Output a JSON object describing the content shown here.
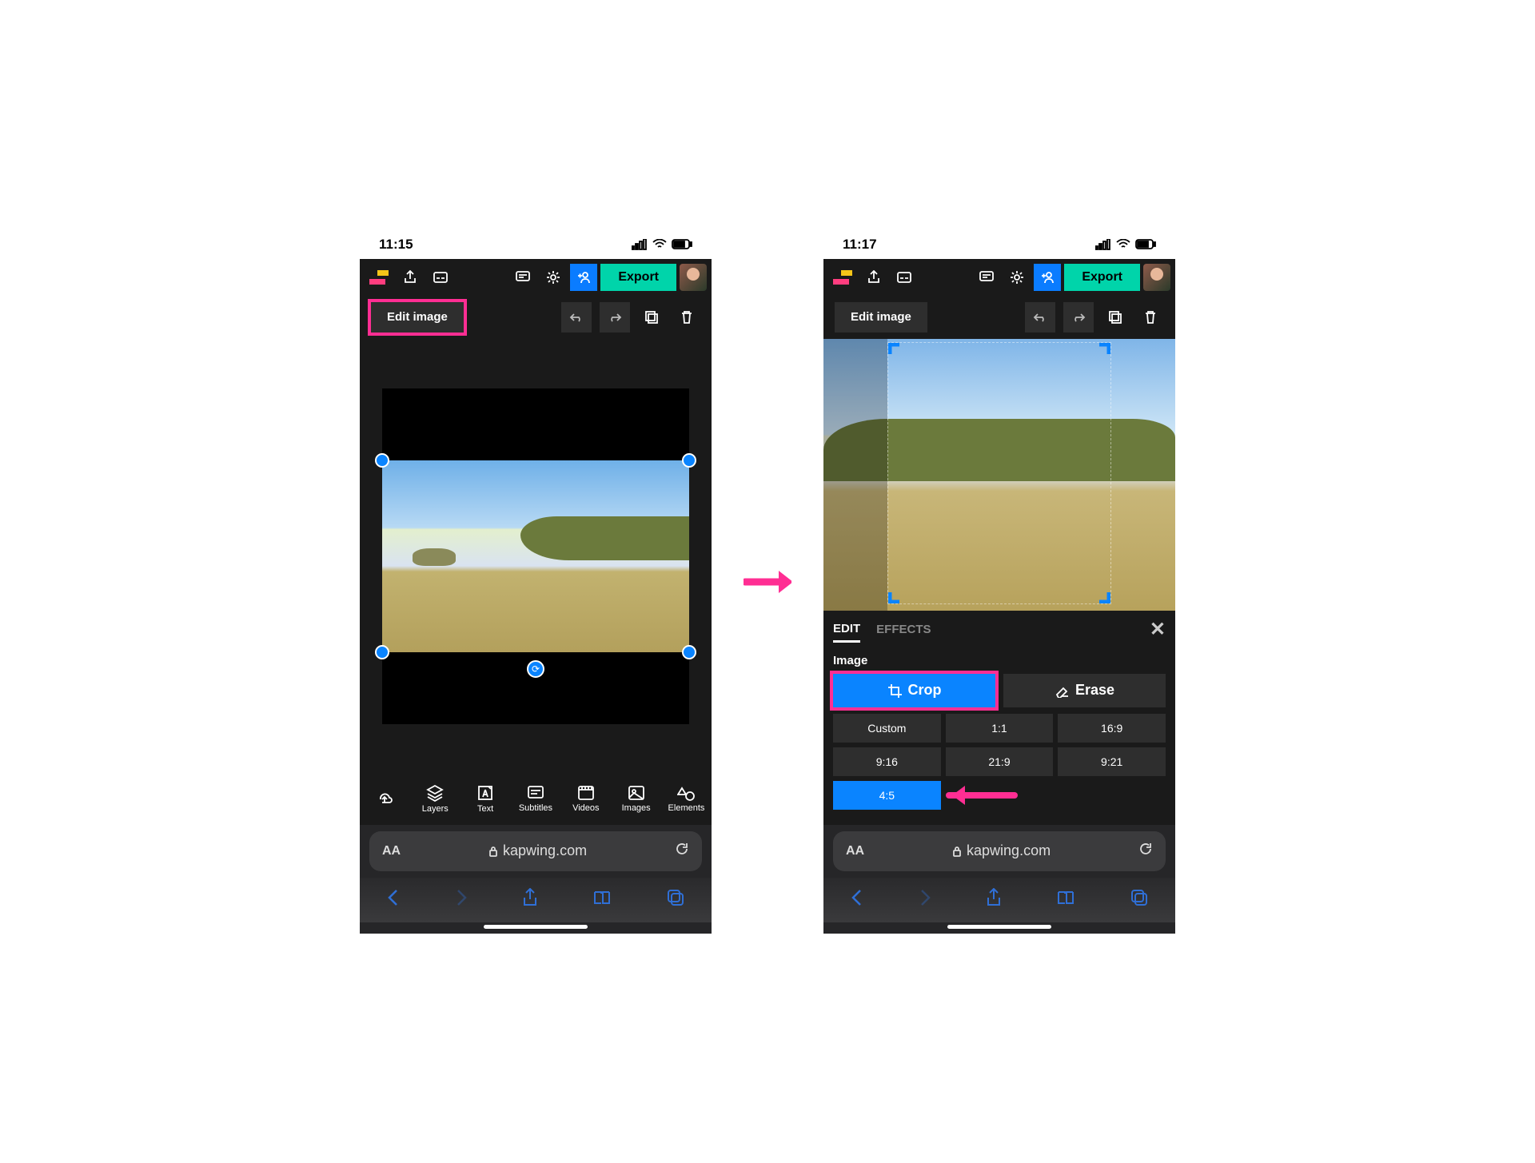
{
  "status": {
    "time1": "11:15",
    "time2": "11:17"
  },
  "topbar": {
    "export": "Export"
  },
  "editbar": {
    "edit_image": "Edit image"
  },
  "bottom_tools": {
    "layers": "Layers",
    "text": "Text",
    "subtitles": "Subtitles",
    "videos": "Videos",
    "images": "Images",
    "elements": "Elements"
  },
  "panel": {
    "tab_edit": "EDIT",
    "tab_effects": "EFFECTS",
    "section_label": "Image",
    "crop": "Crop",
    "erase": "Erase",
    "ratios": [
      "Custom",
      "1:1",
      "16:9",
      "9:16",
      "21:9",
      "9:21",
      "4:5"
    ]
  },
  "safari": {
    "aa": "AA",
    "url": "kapwing.com"
  }
}
